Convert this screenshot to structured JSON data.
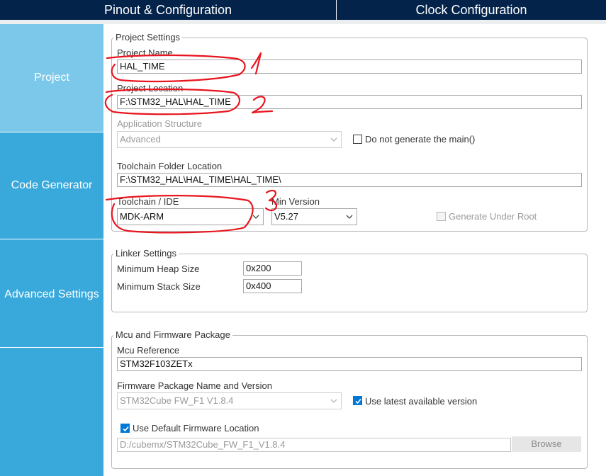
{
  "header": {
    "tabs": [
      {
        "label": "Pinout & Configuration"
      },
      {
        "label": "Clock Configuration"
      }
    ]
  },
  "sidebar": {
    "items": [
      {
        "label": "Project",
        "active": true
      },
      {
        "label": "Code Generator",
        "active": false
      },
      {
        "label": "Advanced Settings",
        "active": false
      },
      {
        "label": "",
        "active": false
      }
    ]
  },
  "project_settings": {
    "legend": "Project Settings",
    "project_name": {
      "label": "Project Name",
      "value": "HAL_TIME"
    },
    "project_location": {
      "label": "Project Location",
      "value": "F:\\STM32_HAL\\HAL_TIME"
    },
    "app_structure": {
      "label": "Application Structure",
      "value": "Advanced"
    },
    "no_main": {
      "label": "Do not generate the main()",
      "checked": false
    },
    "toolchain_folder": {
      "label": "Toolchain Folder Location",
      "value": "F:\\STM32_HAL\\HAL_TIME\\HAL_TIME\\"
    },
    "toolchain_ide": {
      "label": "Toolchain / IDE",
      "value": "MDK-ARM"
    },
    "min_version": {
      "label": "Min Version",
      "value": "V5.27"
    },
    "generate_root": {
      "label": "Generate Under Root",
      "checked": false,
      "disabled": true
    }
  },
  "linker_settings": {
    "legend": "Linker Settings",
    "heap": {
      "label": "Minimum Heap Size",
      "value": "0x200"
    },
    "stack": {
      "label": "Minimum Stack Size",
      "value": "0x400"
    }
  },
  "mcu_package": {
    "legend": "Mcu and Firmware Package",
    "mcu_ref": {
      "label": "Mcu Reference",
      "value": "STM32F103ZETx"
    },
    "fw_pkg": {
      "label": "Firmware Package Name and Version",
      "value": "STM32Cube FW_F1 V1.8.4"
    },
    "use_latest": {
      "label": "Use latest available version",
      "checked": true
    },
    "use_default_location": {
      "label": "Use Default Firmware Location",
      "checked": true
    },
    "fw_location": {
      "value": "D:/cubemx/STM32Cube_FW_F1_V1.8.4"
    },
    "browse_label": "Browse"
  },
  "annotations": {
    "color": "#e8141e",
    "marks": [
      "1",
      "2",
      "3"
    ]
  }
}
